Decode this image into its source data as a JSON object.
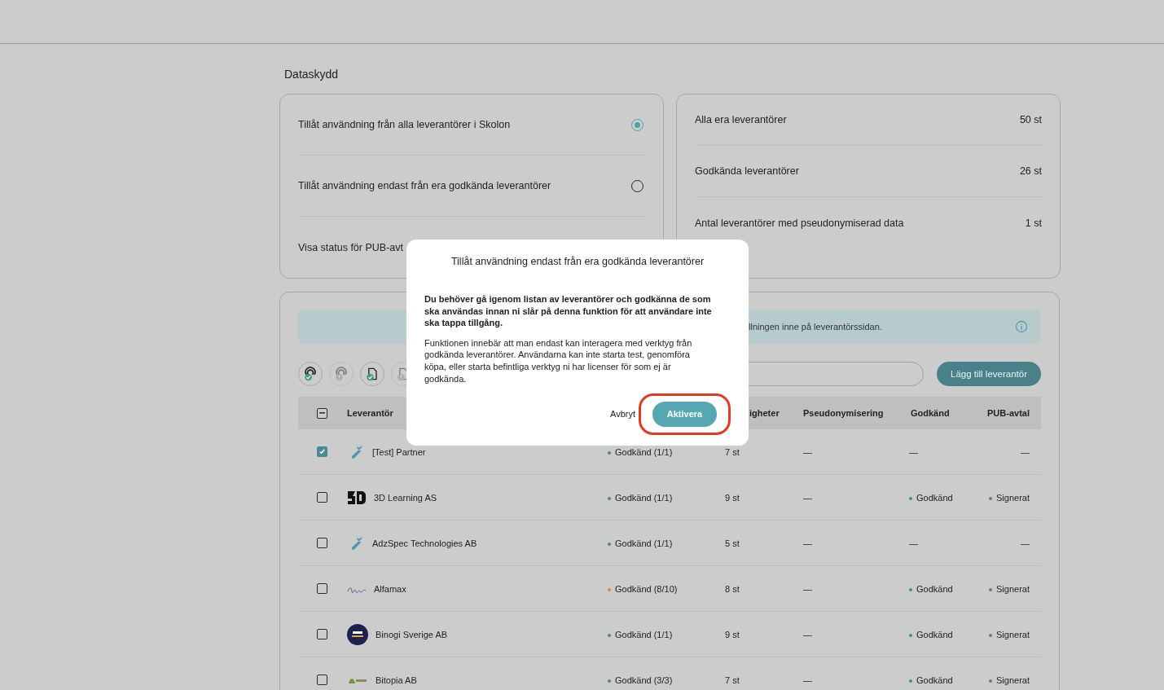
{
  "section_title": "Dataskydd",
  "access_options": [
    {
      "label": "Tillåt användning från alla leverantörer i Skolon",
      "selected": true
    },
    {
      "label": "Tillåt användning endast från era godkända leverantörer",
      "selected": false
    }
  ],
  "pub_status_label": "Visa status för PUB-avt",
  "stats": [
    {
      "label": "Alla era leverantörer",
      "value": "50 st"
    },
    {
      "label": "Godkända leverantörer",
      "value": "26 st"
    },
    {
      "label": "Antal leverantörer med pseudonymiserad data",
      "value": "1 st"
    }
  ],
  "info_banner": {
    "text": "llningen inne på leverantörssidan."
  },
  "filters": [
    {
      "kind": "audio",
      "active": true
    },
    {
      "kind": "audio",
      "active": false
    },
    {
      "kind": "document",
      "active": true
    },
    {
      "kind": "document",
      "active": false
    }
  ],
  "add_button": "Lägg till leverantör",
  "table": {
    "header_partial": true,
    "columns": {
      "supplier": "Leverantör",
      "column_4": "igheter",
      "pseudonymisation": "Pseudonymisering",
      "approved": "Godkänd",
      "pub_agreement": "PUB-avtal"
    },
    "rows": [
      {
        "checked": true,
        "kind": "wrench",
        "name": "[Test] Partner",
        "status": {
          "text": "Godkänd (1/1)",
          "color": "#4f8f63"
        },
        "count": "7 st",
        "pseudonymisation": "—",
        "approved": {
          "text": "—"
        },
        "pub_agreement": {
          "text": "—"
        }
      },
      {
        "checked": false,
        "kind": "cube",
        "name": "3D Learning AS",
        "status": {
          "text": "Godkänd (1/1)",
          "color": "#4f8f63"
        },
        "count": "9 st",
        "pseudonymisation": "—",
        "approved": {
          "text": "Godkänd",
          "color": "#4f8f63"
        },
        "pub_agreement": {
          "text": "Signerat",
          "color": "#4f8f63"
        }
      },
      {
        "checked": false,
        "kind": "wrench",
        "name": "AdzSpec Technologies AB",
        "status": {
          "text": "Godkänd (1/1)",
          "color": "#4f8f63"
        },
        "count": "5 st",
        "pseudonymisation": "—",
        "approved": {
          "text": "—"
        },
        "pub_agreement": {
          "text": "—"
        }
      },
      {
        "checked": false,
        "kind": "script",
        "name": "Alfamax",
        "status": {
          "text": "Godkänd (8/10)",
          "color": "#d98a2b"
        },
        "count": "8 st",
        "pseudonymisation": "—",
        "approved": {
          "text": "Godkänd",
          "color": "#4f8f63"
        },
        "pub_agreement": {
          "text": "Signerat",
          "color": "#4f8f63"
        }
      },
      {
        "checked": false,
        "kind": "round",
        "name": "Binogi Sverige AB",
        "status": {
          "text": "Godkänd (1/1)",
          "color": "#4f8f63"
        },
        "count": "9 st",
        "pseudonymisation": "—",
        "approved": {
          "text": "Godkänd",
          "color": "#4f8f63"
        },
        "pub_agreement": {
          "text": "Signerat",
          "color": "#4f8f63"
        }
      },
      {
        "checked": false,
        "kind": "leaf",
        "name": "Bitopia AB",
        "status": {
          "text": "Godkänd (3/3)",
          "color": "#4f8f63"
        },
        "count": "7 st",
        "pseudonymisation": "—",
        "approved": {
          "text": "Godkänd",
          "color": "#4f8f63"
        },
        "pub_agreement": {
          "text": "Signerat",
          "color": "#4f8f63"
        }
      }
    ]
  },
  "modal": {
    "title": "Tillåt användning endast från era godkända leverantörer",
    "warning": "Du behöver gå igenom listan av leverantörer och godkänna de som ska användas innan ni slår på denna funktion för att användare inte ska tappa tillgång.",
    "body": "Funktionen innebär att man endast kan interagera med verktyg från godkända leverantörer. Användarna kan inte starta test, genomföra köpa, eller starta befintliga verktyg ni har licenser för som ej är godkända.",
    "cancel": "Avbryt",
    "confirm": "Aktivera",
    "confirm_highlighted": true
  }
}
